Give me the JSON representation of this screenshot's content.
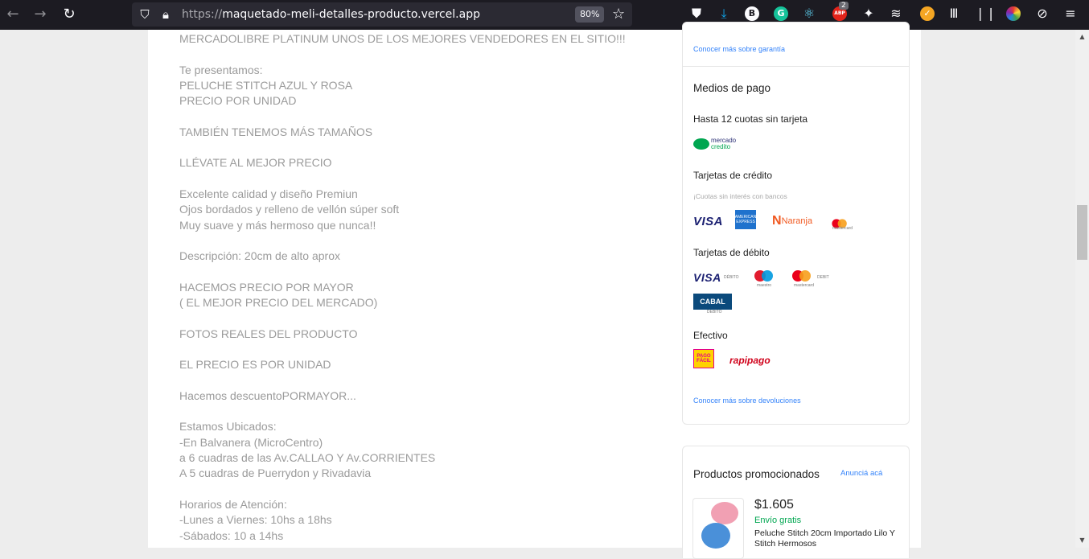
{
  "browser": {
    "url_protocol": "https://",
    "url_host": "maquetado-meli-detalles-producto.vercel.app",
    "zoom": "80%",
    "ext_badge_count": "2",
    "ext_abp_label": "ABP",
    "ext_b_label": "B",
    "ext_g_label": "G",
    "accent_colors": {
      "grammarly": "#15c39a",
      "abp": "#e2231a",
      "react": "#61dafb"
    }
  },
  "description": {
    "lines": "MERCADOLIBRE PLATINUM UNOS DE LOS MEJORES VENDEDORES EN EL SITIO!!!\n\nTe presentamos:\nPELUCHE STITCH AZUL Y ROSA\nPRECIO POR UNIDAD\n\nTAMBIÉN TENEMOS MÁS TAMAÑOS\n\nLLÉVATE AL MEJOR PRECIO\n\nExcelente calidad y diseño Premiun\nOjos bordados y relleno de vellón súper soft\nMuy suave y más hermoso que nunca!!\n\nDescripción: 20cm de alto aprox\n\nHACEMOS PRECIO POR MAYOR\n( EL MEJOR PRECIO DEL MERCADO)\n\nFOTOS REALES DEL PRODUCTO\n\nEL PRECIO ES POR UNIDAD\n\nHacemos descuentoPORMAYOR...\n\nEstamos Ubicados:\n-En Balvanera (MicroCentro)\na 6 cuadras de las Av.CALLAO Y Av.CORRIENTES\nA 5 cuadras de Puerrydon y Rivadavia\n\nHorarios de Atención:\n-Lunes a Viernes: 10hs a 18hs\n-Sábados: 10 a 14hs"
  },
  "warranty": {
    "link": "Conocer más sobre garantía"
  },
  "payment": {
    "title": "Medios de pago",
    "installments_title": "Hasta 12 cuotas sin tarjeta",
    "mercado_credito": {
      "line1": "mercado",
      "line2": "credito"
    },
    "credit_title": "Tarjetas de crédito",
    "credit_note": "¡Cuotas sin interés con bancos",
    "credit_cards": {
      "visa": "VISA",
      "amex": "AMERICAN EXPRESS",
      "naranja_mark": "N",
      "naranja": "Naranja",
      "mastercard_caption": "mastercard"
    },
    "debit_title": "Tarjetas de débito",
    "debit_cards": {
      "visa": "VISA",
      "visa_caption": "DÉBITO",
      "maestro_caption": "maestro",
      "mastercard_caption": "mastercard",
      "mastercard_debit": "DEBIT",
      "cabal": "CABAL",
      "cabal_caption": "DEBITO"
    },
    "cash_title": "Efectivo",
    "cash": {
      "pagofacil": "PAGO FÁCIL",
      "rapipago": "rapipago"
    },
    "returns_link": "Conocer más sobre devoluciones"
  },
  "promoted": {
    "title": "Productos promocionados",
    "advertise_link": "Anunciá acá",
    "product": {
      "price": "$1.605",
      "shipping": "Envío gratis",
      "title": "Peluche Stitch 20cm Importado Lilo Y Stitch Hermosos"
    }
  }
}
